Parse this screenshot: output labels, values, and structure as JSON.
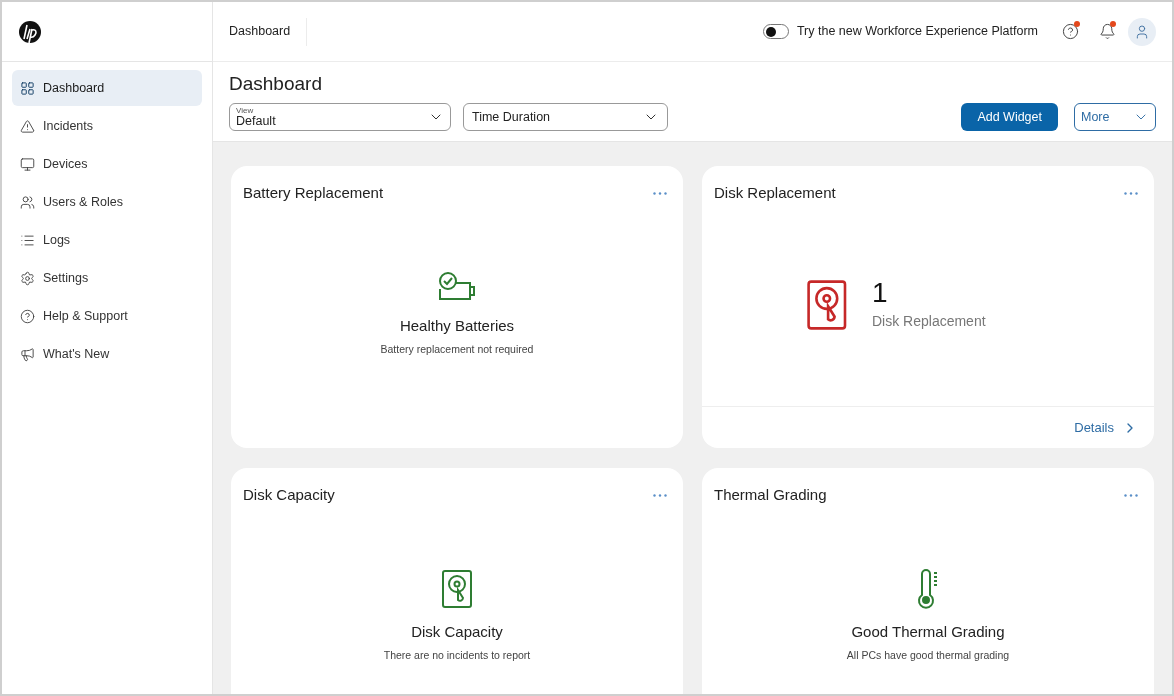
{
  "topbar": {
    "breadcrumb": "Dashboard",
    "toggle": {
      "label": "Try the new Workforce Experience Platform",
      "on": false
    },
    "help_badge": true,
    "notification_badge": true
  },
  "sidebar": {
    "items": [
      {
        "label": "Dashboard",
        "selected": true
      },
      {
        "label": "Incidents",
        "selected": false
      },
      {
        "label": "Devices",
        "selected": false
      },
      {
        "label": "Users & Roles",
        "selected": false
      },
      {
        "label": "Logs",
        "selected": false
      },
      {
        "label": "Settings",
        "selected": false
      },
      {
        "label": "Help & Support",
        "selected": false
      },
      {
        "label": "What's New",
        "selected": false
      }
    ]
  },
  "page": {
    "title": "Dashboard",
    "view_select": {
      "label": "View",
      "value": "Default"
    },
    "time_select": {
      "placeholder": "Time Duration"
    },
    "add_button": "Add Widget",
    "more_select": "More"
  },
  "widgets": [
    {
      "title": "Battery Replacement",
      "kind": "battery",
      "alert": false,
      "headline": "Healthy Batteries",
      "subtitle": "Battery replacement not required"
    },
    {
      "title": "Disk Replacement",
      "kind": "replacement",
      "alert": true,
      "count": "1",
      "label": "Disk Replacement",
      "link": "Details"
    },
    {
      "title": "Disk Capacity",
      "kind": "capacity",
      "alert": false,
      "headline": "Disk Capacity",
      "subtitle": "There are no incidents to report"
    },
    {
      "title": "Thermal Grading",
      "kind": "thermal",
      "alert": false,
      "headline": "Good Thermal Grading",
      "subtitle": "All PCs have good thermal grading"
    }
  ]
}
